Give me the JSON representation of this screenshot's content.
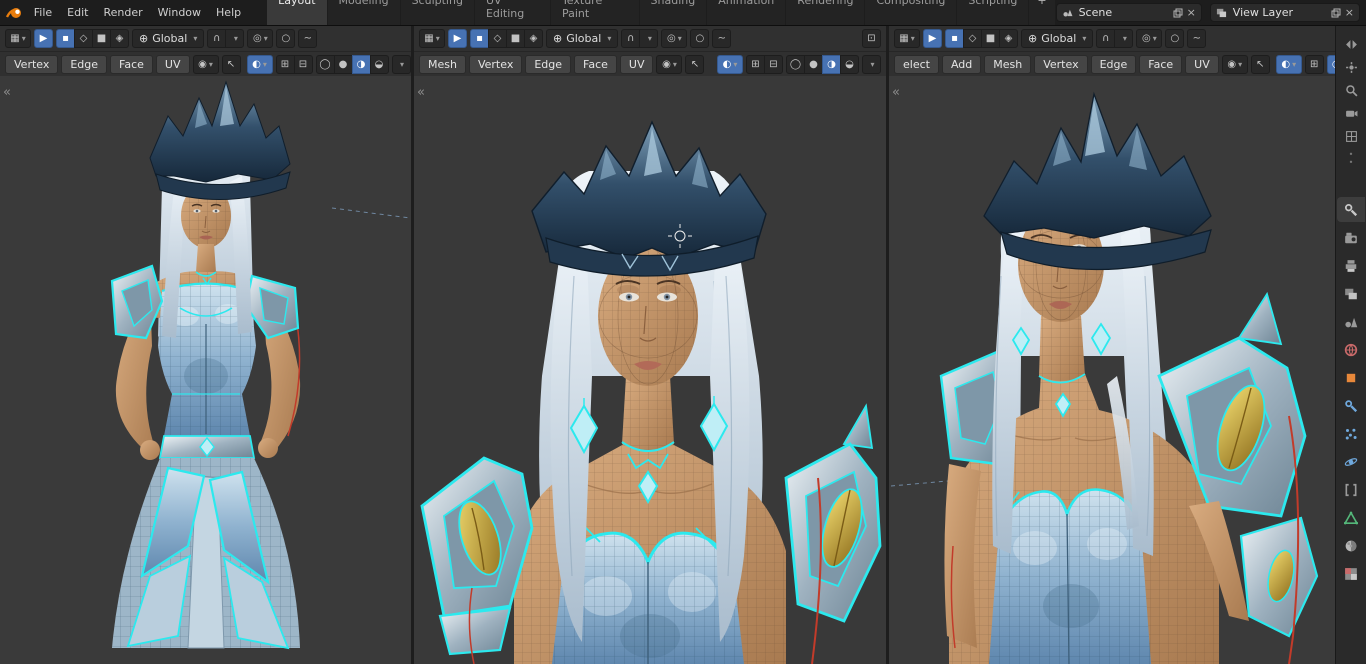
{
  "topbar": {
    "menus": [
      "File",
      "Edit",
      "Render",
      "Window",
      "Help"
    ],
    "tabs": [
      "Layout",
      "Modeling",
      "Sculpting",
      "UV Editing",
      "Texture Paint",
      "Shading",
      "Animation",
      "Rendering",
      "Compositing",
      "Scripting"
    ],
    "active_tab": "Layout",
    "add_tab": "+",
    "scene": {
      "label": "Scene"
    },
    "view_layer": {
      "label": "View Layer"
    }
  },
  "viewports": [
    {
      "orientation": "Global",
      "buttons": [
        "Vertex",
        "Edge",
        "Face",
        "UV"
      ]
    },
    {
      "orientation": "Global",
      "buttons": [
        "Mesh",
        "Vertex",
        "Edge",
        "Face",
        "UV"
      ]
    },
    {
      "orientation": "Global",
      "buttons": [
        "elect",
        "Add",
        "Mesh",
        "Vertex",
        "Edge",
        "Face",
        "UV"
      ]
    }
  ],
  "icons": {
    "dropdown": "▾",
    "editor": "▦",
    "tweak": "▶",
    "vertex_mode": "▪",
    "edge_mode": "◇",
    "face_mode": "■",
    "extra_mode": "◈",
    "orientation": "⊕",
    "snap": "∩",
    "pivot": "◎",
    "proportional": "○",
    "falloff": "∼",
    "visibility": "◉",
    "cursor": "↖",
    "overlays": "⊞",
    "xray": "⊟",
    "wireframe": "◯",
    "solid": "●",
    "material": "◐",
    "matcap": "◑",
    "rendered": "◒",
    "fullscreen": "⊡",
    "collapse": "«",
    "close": "×"
  },
  "sidebar": {
    "top_icons": [
      "expand-arrows",
      "axis-gizmo",
      "magnifier",
      "camera-view",
      "grid-toggle"
    ],
    "tabs": [
      "tool",
      "render",
      "output",
      "view-layer",
      "scene",
      "world",
      "object",
      "modifiers",
      "particles",
      "physics",
      "constraints",
      "object-data",
      "material",
      "texture"
    ]
  },
  "colors": {
    "accent_blue": "#4772b3",
    "selection_cyan": "#2ce9ee",
    "blender_orange": "#e87d0d",
    "viewport_bg": "#3a3a3a"
  }
}
